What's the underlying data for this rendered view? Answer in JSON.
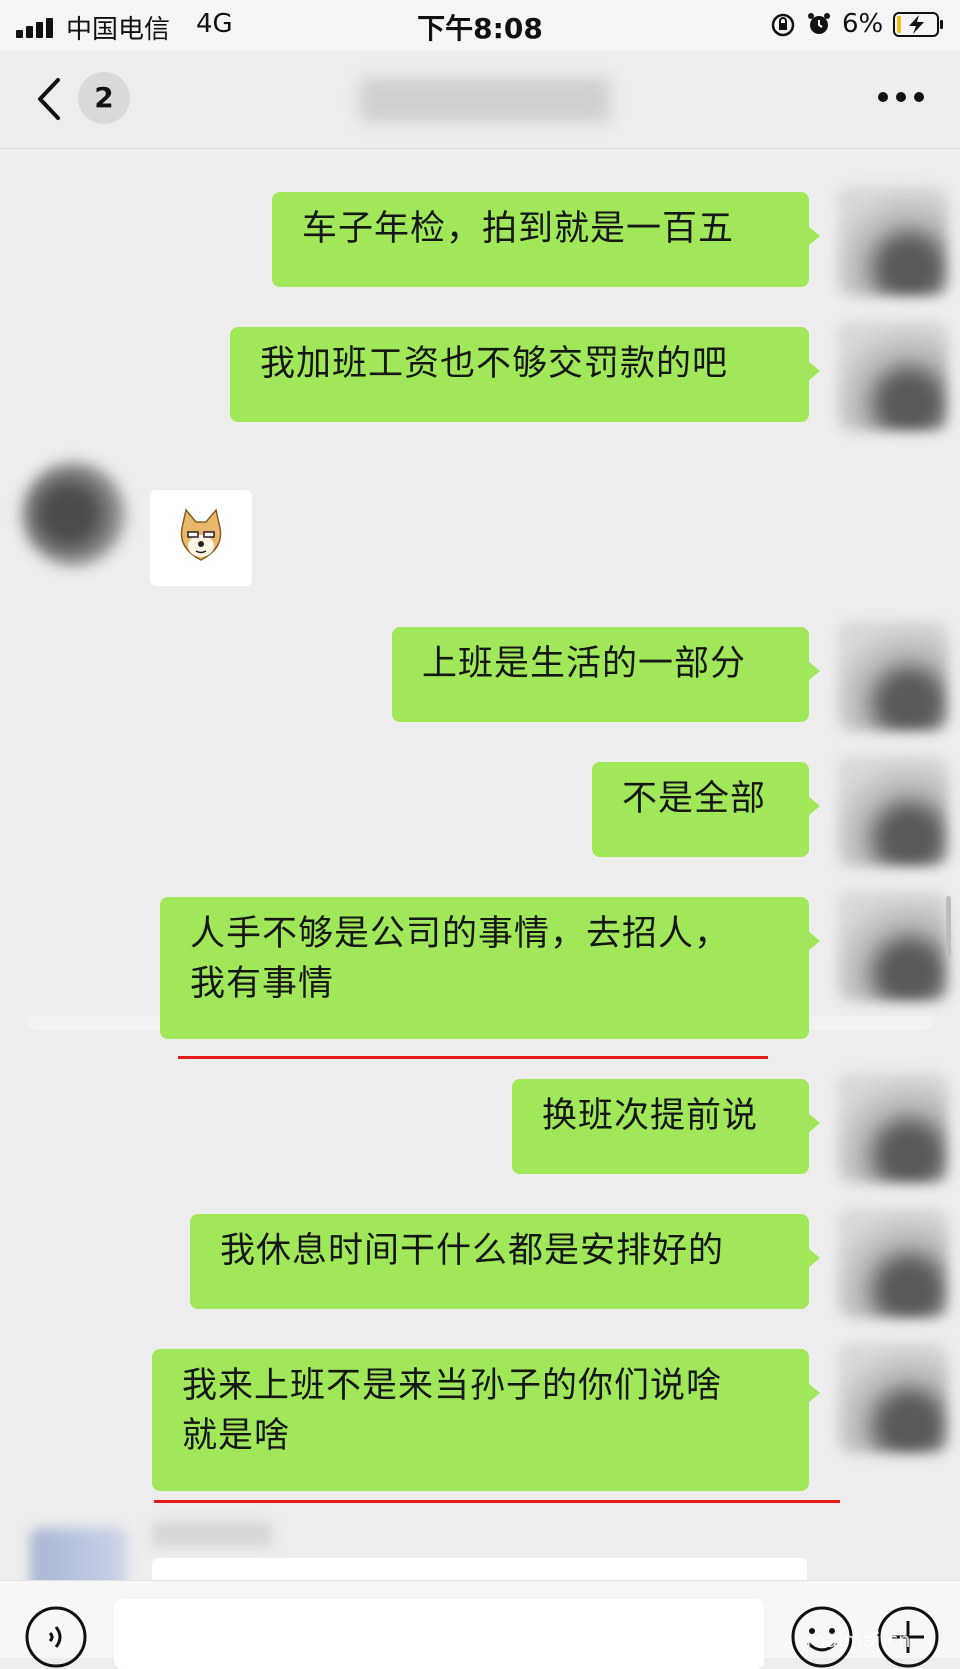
{
  "status_bar": {
    "carrier": "中国电信",
    "network": "4G",
    "time": "下午8:08",
    "battery_percent": "6%",
    "battery_level": 0.06,
    "icons": [
      "signal-icon",
      "orientation-lock-icon",
      "alarm-icon",
      "battery-charging-icon"
    ]
  },
  "nav": {
    "back_icon": "chevron-left-icon",
    "unread_count": "2",
    "more_icon": "ellipsis-icon"
  },
  "messages": [
    {
      "side": "right",
      "text": "车子年检，拍到就是一百五"
    },
    {
      "side": "right",
      "text": "我加班工资也不够交罚款的吧"
    },
    {
      "side": "left",
      "type": "sticker",
      "sticker": "doge-emoji"
    },
    {
      "side": "right",
      "text": "上班是生活的一部分"
    },
    {
      "side": "right",
      "text": "不是全部"
    },
    {
      "side": "right",
      "lines": [
        "人手不够是公司的事情，去招人，",
        "我有事情"
      ]
    },
    {
      "side": "right",
      "text": "换班次提前说"
    },
    {
      "side": "right",
      "text": "我休息时间干什么都是安排好的"
    },
    {
      "side": "right",
      "lines": [
        "我来上班不是来当孙子的你们说啥",
        "就是啥"
      ]
    }
  ],
  "annotations": {
    "underline_color": "#e51b1b"
  },
  "input_bar": {
    "voice_icon": "voice-icon",
    "emoji_icon": "emoji-icon",
    "plus_icon": "plus-icon"
  },
  "colors": {
    "bubble_self": "#a0e75a",
    "background": "#ededed"
  },
  "watermark": "maimai.cn"
}
